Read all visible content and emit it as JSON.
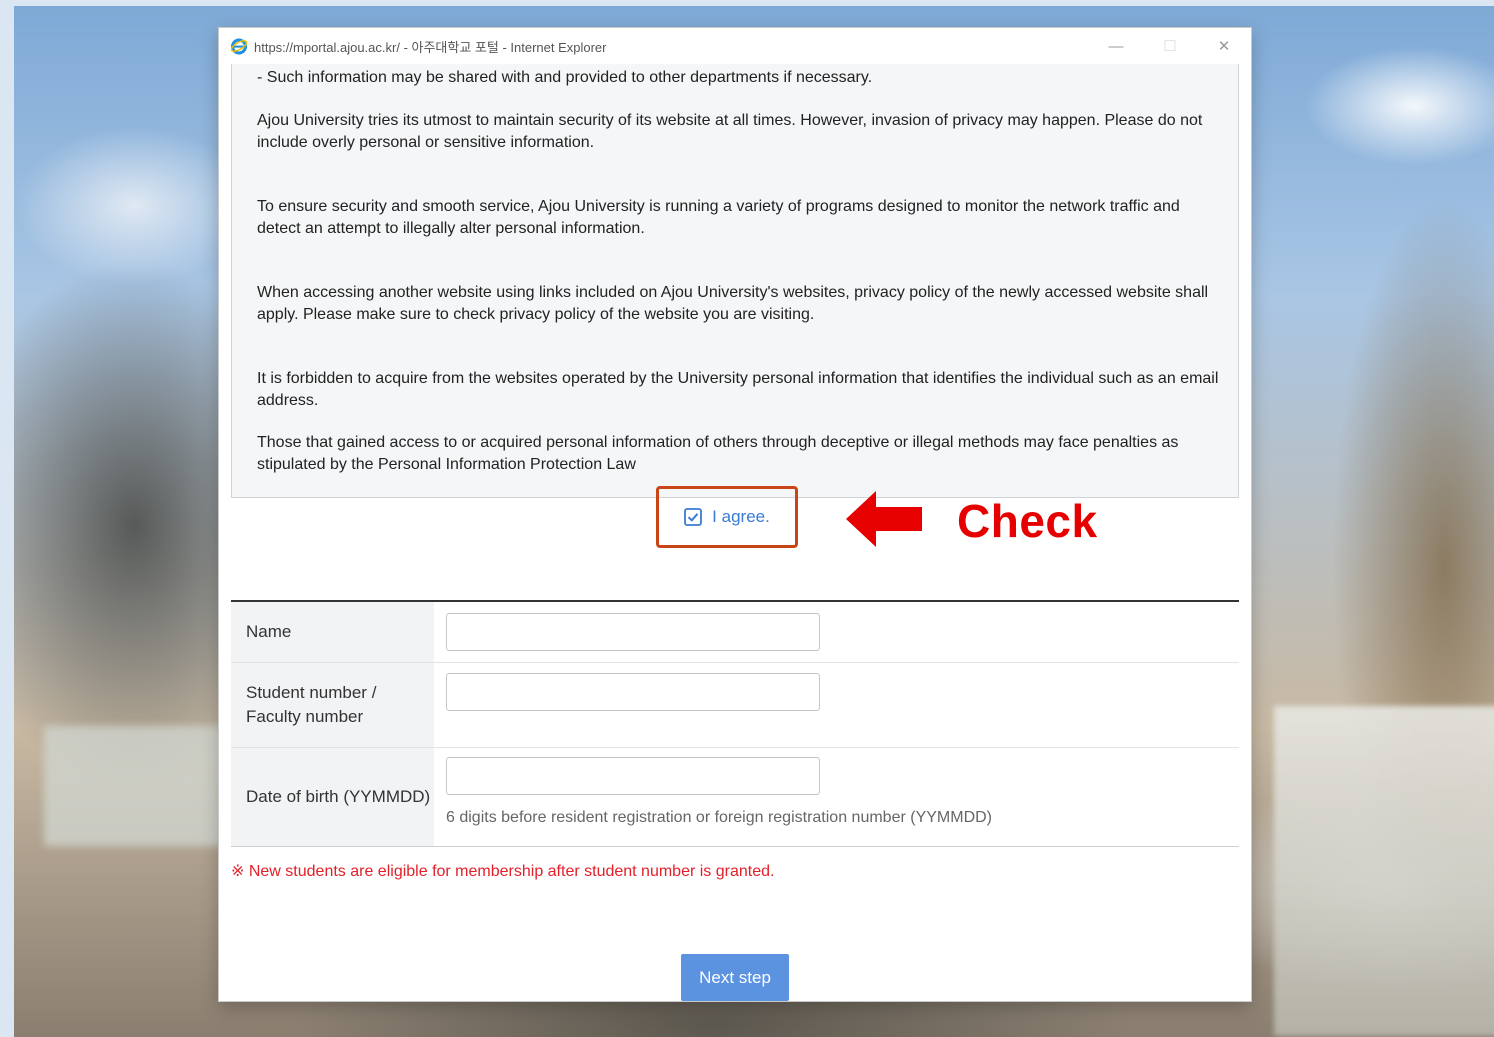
{
  "window": {
    "title": "https://mportal.ajou.ac.kr/ - 아주대학교 포털 - Internet Explorer",
    "minimize": "—",
    "maximize": "☐",
    "close": "✕"
  },
  "terms": {
    "paragraphs": [
      "- Such information may be shared with and provided to other departments if necessary.",
      "Ajou University tries its utmost to maintain security of its website at all times. However, invasion of privacy may happen. Please do not include overly personal or sensitive information.",
      "To ensure security and smooth service, Ajou University is running a variety of programs designed to monitor the network traffic and detect an attempt to illegally alter personal information.",
      "When accessing another website using links included on Ajou University's websites, privacy policy of the newly accessed website shall apply. Please make sure to check privacy policy of the website you are visiting.",
      "It is forbidden to acquire from the websites operated by the University personal information that identifies the individual such as an email address.",
      "Those that gained access to or acquired personal information of others through deceptive or illegal methods may face penalties as stipulated by the Personal Information Protection Law"
    ]
  },
  "agree": {
    "label": "I agree.",
    "checked": true
  },
  "annotation": {
    "text": "Check",
    "color": "#e60000"
  },
  "form": {
    "name_label": "Name",
    "student_label": "Student number / Faculty number",
    "dob_label": "Date of birth (YYMMDD)",
    "dob_hint": "6 digits before resident registration or foreign registration number (YYMMDD)",
    "name_value": "",
    "student_value": "",
    "dob_value": ""
  },
  "notice": "※ New students are eligible for membership after student number is granted.",
  "next_button": "Next step",
  "colors": {
    "accent": "#5b93e0",
    "link": "#3a7bd5",
    "highlight_border": "#c84515",
    "warning": "#e2202a"
  }
}
